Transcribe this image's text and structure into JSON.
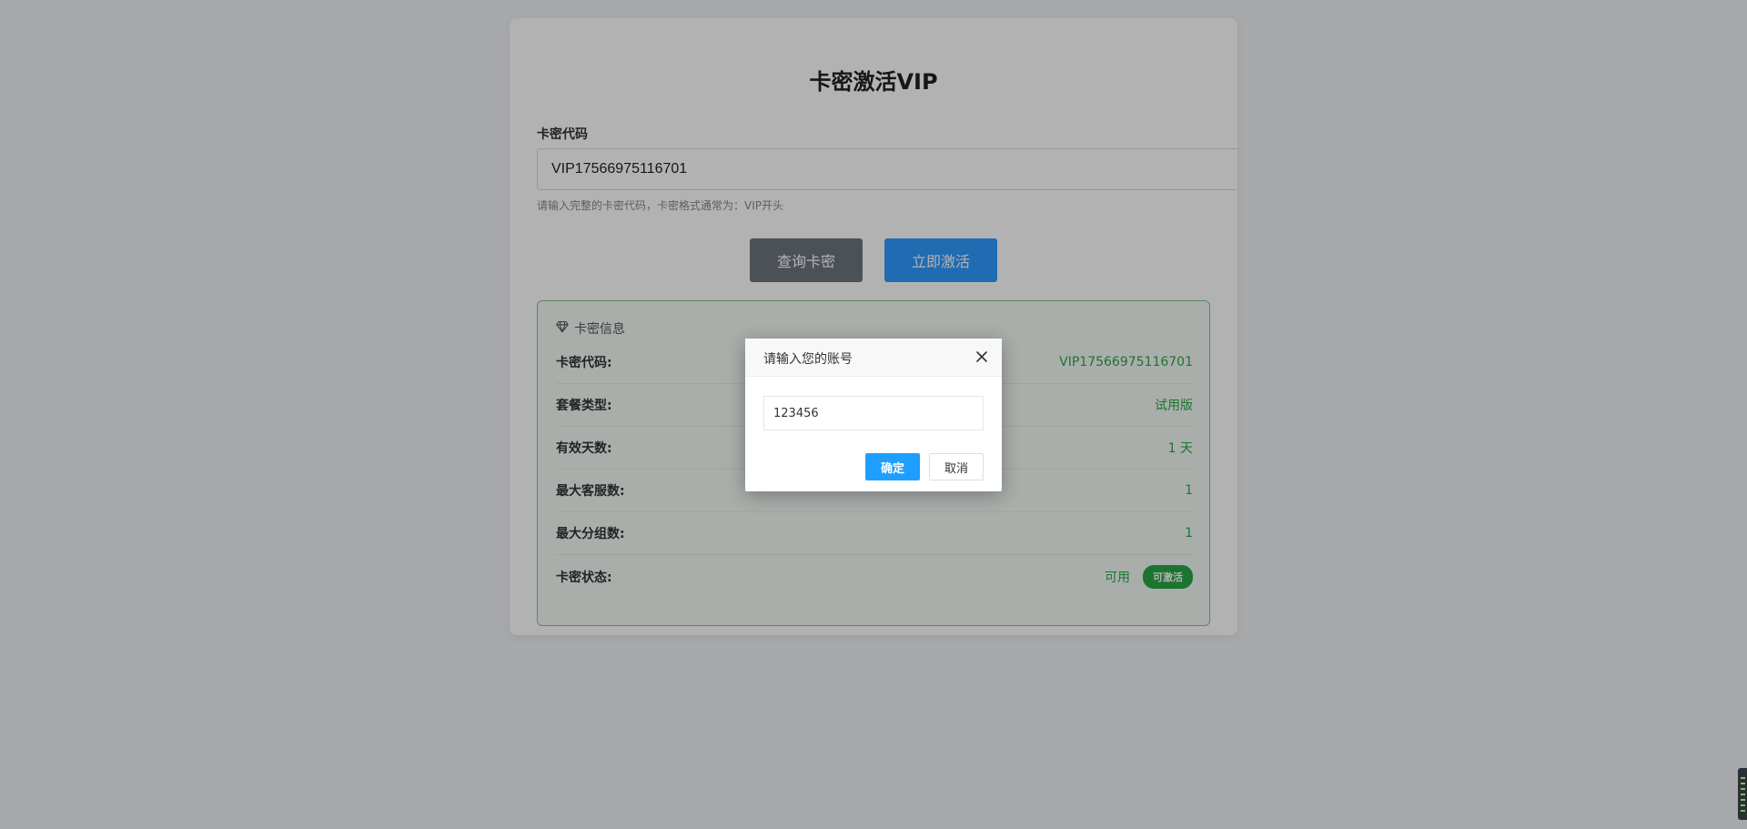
{
  "title": "卡密激活VIP",
  "form": {
    "label": "卡密代码",
    "code_value": "VIP17566975116701",
    "hint": "请输入完整的卡密代码，卡密格式通常为：VIP开头"
  },
  "actions": {
    "query_label": "查询卡密",
    "activate_label": "立即激活"
  },
  "info": {
    "header": "卡密信息",
    "header_icon": "diamond-icon",
    "rows": [
      {
        "label": "卡密代码:",
        "value": "VIP17566975116701"
      },
      {
        "label": "套餐类型:",
        "value": "试用版"
      },
      {
        "label": "有效天数:",
        "value": "1 天"
      },
      {
        "label": "最大客服数:",
        "value": "1"
      },
      {
        "label": "最大分组数:",
        "value": "1"
      },
      {
        "label": "卡密状态:",
        "value": "可用",
        "badge": "可激活"
      }
    ],
    "accent_color": "#28a745"
  },
  "dialog": {
    "title": "请输入您的账号",
    "input_value": "123456",
    "ok_label": "确定",
    "cancel_label": "取消",
    "close_icon": "close-icon",
    "ok_color": "#1e9fff"
  }
}
